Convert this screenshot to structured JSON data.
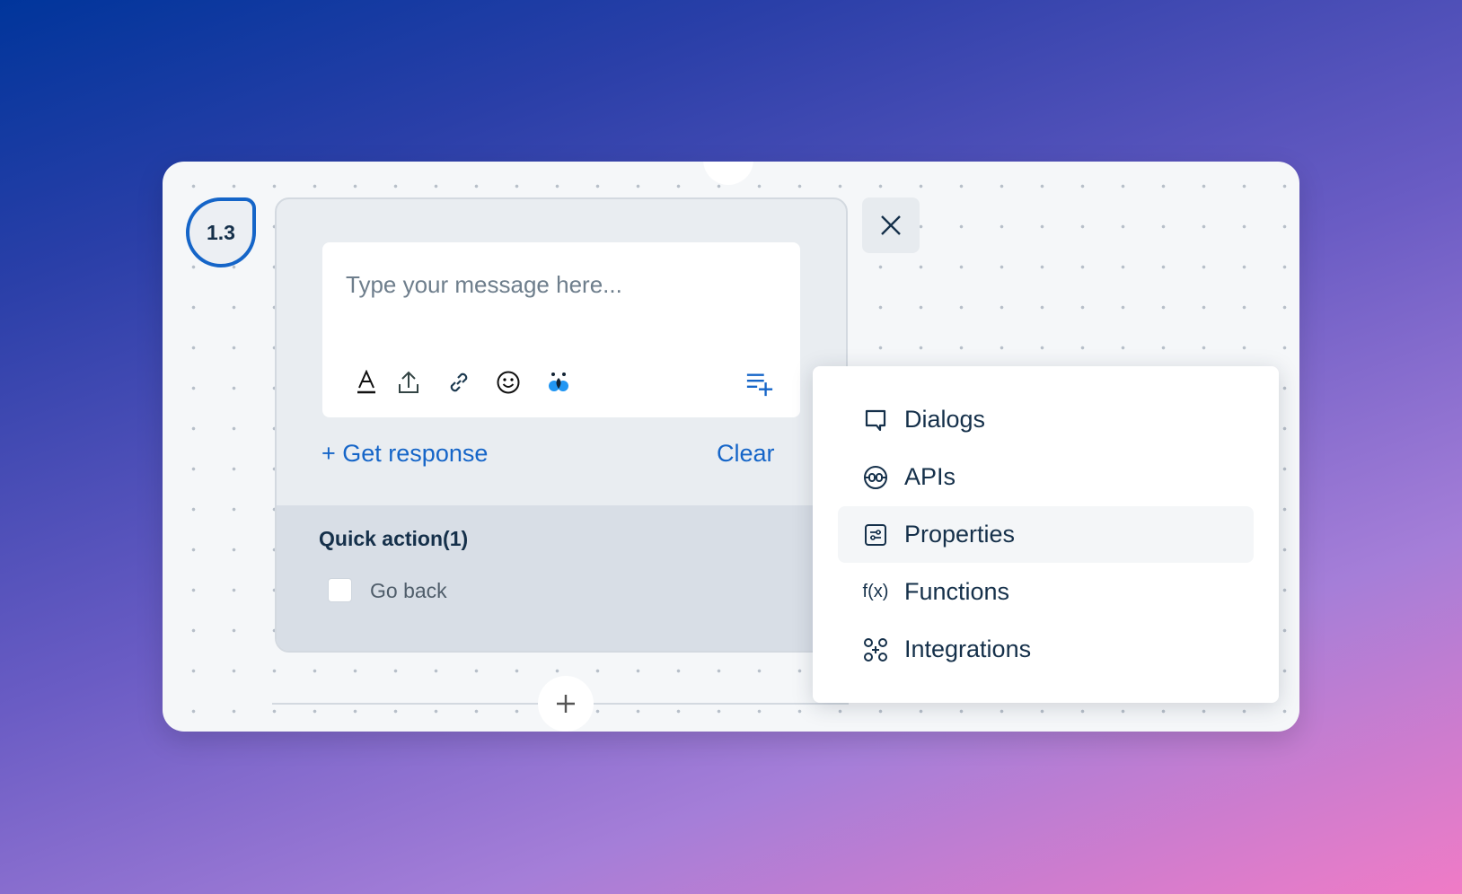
{
  "node": {
    "badge": "1.3"
  },
  "composer": {
    "placeholder": "Type your message here...",
    "tools": [
      "text-format-icon",
      "upload-icon",
      "link-icon",
      "emoji-icon",
      "ai-assistant-icon",
      "add-list-icon"
    ]
  },
  "actions": {
    "get_response": "+ Get response",
    "clear": "Clear"
  },
  "quick_actions": {
    "title": "Quick action(1)",
    "items": [
      {
        "label": "Go back",
        "checked": false
      }
    ]
  },
  "menu": {
    "items": [
      {
        "label": "Dialogs",
        "icon": "chat-bubble-icon"
      },
      {
        "label": "APIs",
        "icon": "api-icon"
      },
      {
        "label": "Properties",
        "icon": "sliders-icon",
        "highlighted": true
      },
      {
        "label": "Functions",
        "icon": "function-icon"
      },
      {
        "label": "Integrations",
        "icon": "integrations-icon"
      }
    ]
  },
  "colors": {
    "accent": "#1565c8",
    "text": "#15304a"
  }
}
